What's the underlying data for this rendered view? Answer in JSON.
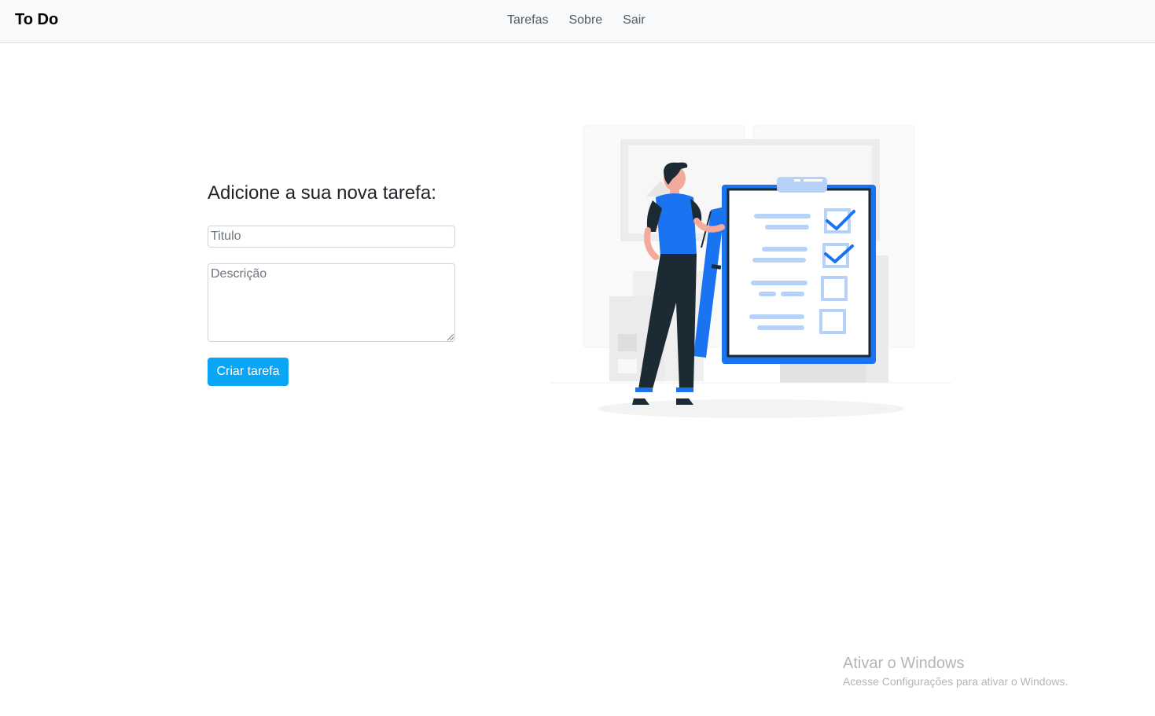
{
  "navbar": {
    "brand": "To Do",
    "links": [
      "Tarefas",
      "Sobre",
      "Sair"
    ]
  },
  "form": {
    "heading": "Adicione a sua nova tarefa:",
    "title_placeholder": "Titulo",
    "description_placeholder": "Descrição",
    "submit_label": "Criar tarefa"
  },
  "colors": {
    "accent": "#0aa5f5",
    "illustration_blue": "#1a73f0",
    "illustration_light_blue": "#b7d2f8",
    "illustration_dark": "#1c2b33"
  },
  "watermark": {
    "title": "Ativar o Windows",
    "subtitle": "Acesse Configurações para ativar o Windows."
  }
}
